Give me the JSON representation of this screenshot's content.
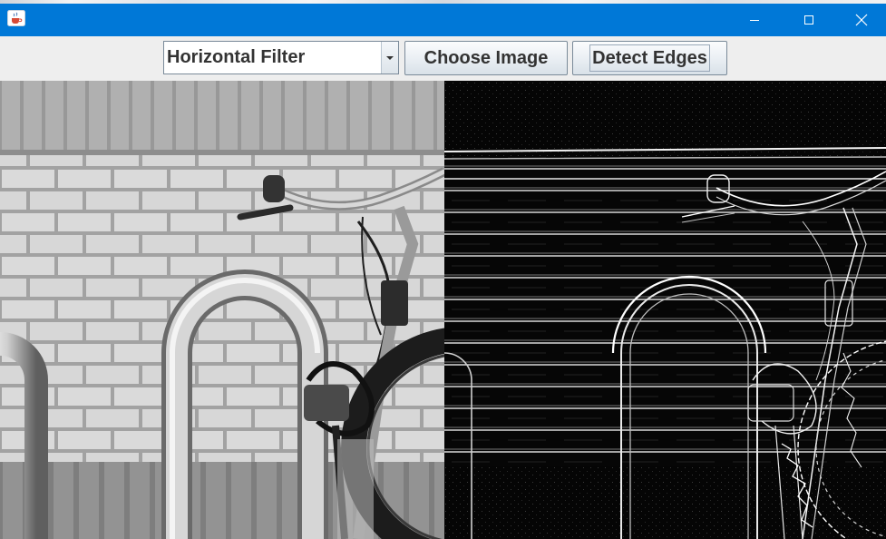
{
  "window": {
    "icon": "java-cup-icon",
    "controls": {
      "minimize_icon": "minimize-icon",
      "maximize_icon": "maximize-icon",
      "close_icon": "close-icon"
    },
    "accent_color": "#0078d7"
  },
  "toolbar": {
    "filter_select": {
      "selected": "Horizontal Filter",
      "arrow_icon": "caret-down-icon"
    },
    "choose_image_label": "Choose Image",
    "detect_edges_label": "Detect Edges"
  },
  "images": {
    "original": {
      "subject": "grayscale photo of a bicycle locked to a bike rack against a brick wall"
    },
    "edges": {
      "subject": "horizontal edge-detection result of the same photo"
    }
  }
}
